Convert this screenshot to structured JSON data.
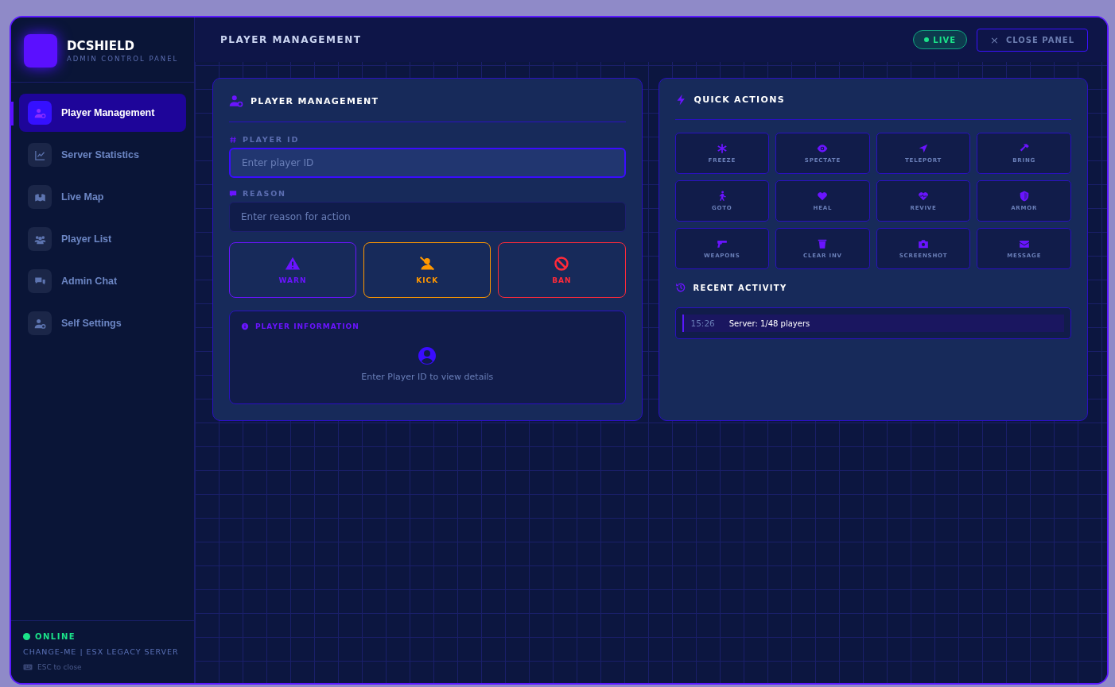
{
  "sidebar": {
    "brand": {
      "title": "DCSHIELD",
      "subtitle": "ADMIN CONTROL PANEL"
    },
    "items": [
      {
        "label": "Player Management",
        "selected": true
      },
      {
        "label": "Server Statistics",
        "selected": false
      },
      {
        "label": "Live Map",
        "selected": false
      },
      {
        "label": "Player List",
        "selected": false
      },
      {
        "label": "Admin Chat",
        "selected": false
      },
      {
        "label": "Self Settings",
        "selected": false
      }
    ],
    "footer": {
      "status": "ONLINE",
      "online": true,
      "server": "CHANGE-ME | ESX LEGACY SERVER",
      "hint": "ESC to close"
    }
  },
  "header": {
    "title": "PLAYER MANAGEMENT",
    "live_badge": {
      "label": "LIVE",
      "on": true
    },
    "close_button": {
      "icon": "×",
      "label": "CLOSE PANEL"
    }
  },
  "player_card": {
    "title": "PLAYER MANAGEMENT",
    "fields": [
      {
        "label": "PLAYER ID",
        "placeholder": "Enter player ID",
        "focused": true
      },
      {
        "label": "REASON",
        "placeholder": "Enter reason for action",
        "focused": false
      }
    ],
    "actions": [
      {
        "label": "WARN",
        "kind": "warn"
      },
      {
        "label": "KICK",
        "kind": "kick"
      },
      {
        "label": "BAN",
        "kind": "ban"
      }
    ],
    "info": {
      "title": "PLAYER INFORMATION",
      "message": "Enter Player ID to view details"
    }
  },
  "quick_card": {
    "title": "QUICK ACTIONS",
    "actions": [
      "FREEZE",
      "SPECTATE",
      "TELEPORT",
      "BRING",
      "GOTO",
      "HEAL",
      "REVIVE",
      "ARMOR",
      "WEAPONS",
      "CLEAR INV",
      "SCREENSHOT",
      "MESSAGE"
    ],
    "activity_title": "RECENT ACTIVITY",
    "activity": [
      {
        "time": "15:26",
        "text": "Server: 1/48 players"
      }
    ]
  }
}
